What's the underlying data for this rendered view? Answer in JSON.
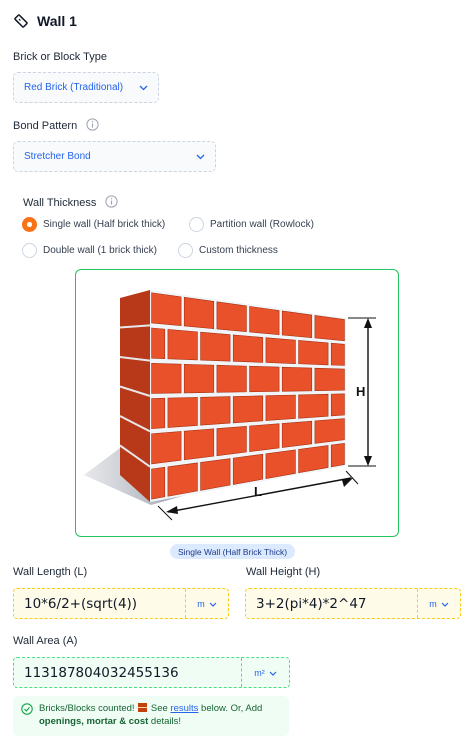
{
  "header": {
    "title": "Wall 1"
  },
  "brick_type": {
    "label": "Brick or Block Type",
    "value": "Red Brick (Traditional)"
  },
  "bond_pattern": {
    "label": "Bond Pattern",
    "value": "Stretcher Bond"
  },
  "wall_thickness": {
    "label": "Wall Thickness",
    "options": [
      {
        "label": "Single wall (Half brick thick)",
        "selected": true
      },
      {
        "label": "Partition wall (Rowlock)",
        "selected": false
      },
      {
        "label": "Double wall (1 brick thick)",
        "selected": false
      },
      {
        "label": "Custom thickness",
        "selected": false
      }
    ]
  },
  "diagram": {
    "height_label": "H",
    "length_label": "L",
    "caption": "Single Wall (Half Brick Thick)"
  },
  "wall_length": {
    "label": "Wall Length (L)",
    "value": "10*6/2+(sqrt(4))",
    "unit": "m"
  },
  "wall_height": {
    "label": "Wall Height (H)",
    "value": "3+2(pi*4)*2^47",
    "unit": "m"
  },
  "wall_area": {
    "label": "Wall Area (A)",
    "value": "113187804032455136",
    "unit": "m²"
  },
  "notice": {
    "part1": "Bricks/Blocks counted!",
    "part2": "See",
    "link": "results",
    "part3": "below. Or, Add",
    "bold": "openings, mortar & cost",
    "part4": "details!"
  },
  "colors": {
    "accent": "#f97316",
    "link": "#2563eb",
    "success": "#22c55e",
    "brick": "#e8512a"
  }
}
